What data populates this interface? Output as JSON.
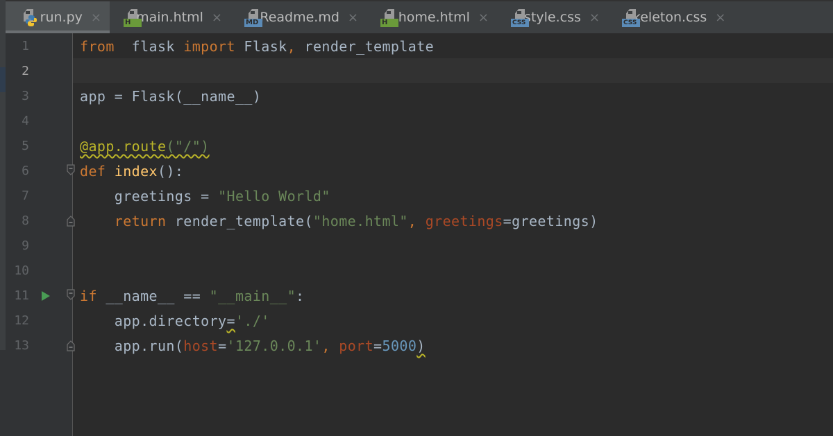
{
  "tabs": [
    {
      "label": "run.py",
      "icon": "python-file-icon",
      "badge": "",
      "active": true
    },
    {
      "label": "main.html",
      "icon": "html-file-icon",
      "badge": "H",
      "active": false
    },
    {
      "label": "Readme.md",
      "icon": "markdown-file-icon",
      "badge": "MD",
      "active": false
    },
    {
      "label": "home.html",
      "icon": "html-file-icon",
      "badge": "H",
      "active": false
    },
    {
      "label": "style.css",
      "icon": "css-file-icon",
      "badge": "CSS",
      "active": false
    },
    {
      "label": "skeleton.css",
      "icon": "css-file-icon",
      "badge": "CSS",
      "active": false
    }
  ],
  "close_glyph": "×",
  "editor": {
    "current_line": 2,
    "lines": [
      {
        "n": "1",
        "tokens": [
          [
            "kw",
            "from"
          ],
          [
            "",
            "  flask "
          ],
          [
            "kw",
            "import"
          ],
          [
            "",
            " Flask"
          ],
          [
            "kw",
            ","
          ],
          [
            "",
            " render_template"
          ]
        ]
      },
      {
        "n": "2",
        "tokens": []
      },
      {
        "n": "3",
        "tokens": [
          [
            "",
            "app = Flask(__name__)"
          ]
        ]
      },
      {
        "n": "4",
        "tokens": []
      },
      {
        "n": "5",
        "tokens": [
          [
            "deco",
            "@app.route"
          ],
          [
            "deco-str",
            "(\"/\")"
          ]
        ]
      },
      {
        "n": "6",
        "tokens": [
          [
            "kw",
            "def"
          ],
          [
            "",
            " "
          ],
          [
            "fn",
            "index"
          ],
          [
            "",
            "():"
          ]
        ]
      },
      {
        "n": "7",
        "tokens": [
          [
            "",
            "    greetings = "
          ],
          [
            "str",
            "\"Hello World\""
          ]
        ]
      },
      {
        "n": "8",
        "tokens": [
          [
            "kw",
            "    return"
          ],
          [
            "",
            " render_template("
          ],
          [
            "str",
            "\"home.html\""
          ],
          [
            "kw",
            ","
          ],
          [
            "",
            " "
          ],
          [
            "param",
            "greetings"
          ],
          [
            "",
            "=greetings)"
          ]
        ]
      },
      {
        "n": "9",
        "tokens": []
      },
      {
        "n": "10",
        "tokens": []
      },
      {
        "n": "11",
        "tokens": [
          [
            "kw",
            "if"
          ],
          [
            "",
            " __name__ == "
          ],
          [
            "str",
            "\"__main__\""
          ],
          [
            "",
            ":"
          ]
        ]
      },
      {
        "n": "12",
        "tokens": [
          [
            "",
            "    app.directory"
          ],
          [
            "warn",
            "="
          ],
          [
            "str",
            "'./'"
          ]
        ]
      },
      {
        "n": "13",
        "tokens": [
          [
            "",
            "    app.run("
          ],
          [
            "param",
            "host"
          ],
          [
            "",
            "="
          ],
          [
            "str",
            "'127.0.0.1'"
          ],
          [
            "kw",
            ","
          ],
          [
            "",
            " "
          ],
          [
            "param",
            "port"
          ],
          [
            "",
            "="
          ],
          [
            "num",
            "5000"
          ],
          [
            "warn",
            ")"
          ]
        ]
      }
    ]
  },
  "gutter_markers": {
    "run_line": 11,
    "fold_open_lines": [
      6,
      11
    ],
    "fold_close_lines": [
      8,
      13
    ]
  }
}
